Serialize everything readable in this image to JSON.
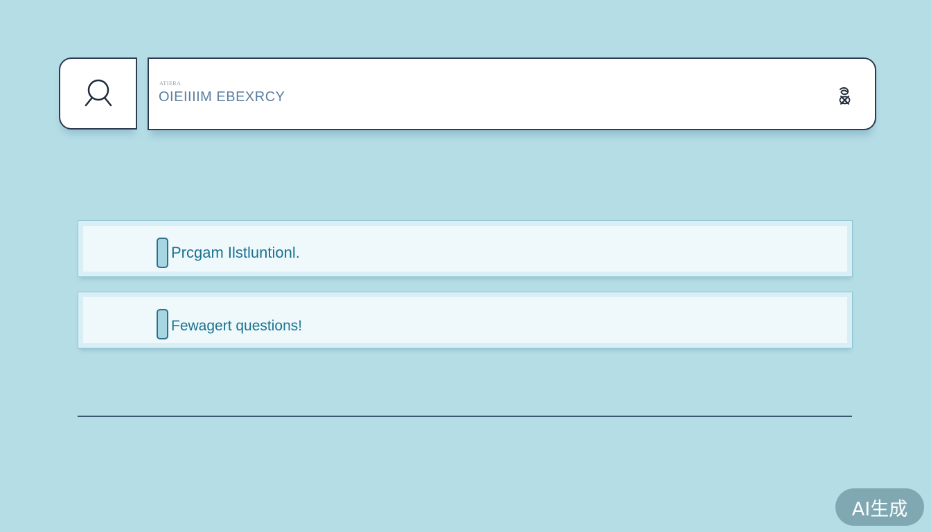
{
  "search": {
    "caption": "ATIERA",
    "value": "OIEIIIIM EBEXRCY",
    "search_icon": "search-icon",
    "clear_icon": "clear-icon"
  },
  "results": [
    {
      "label": "Prcgam Ilstluntionl."
    },
    {
      "label": "Fewagert questions!"
    }
  ],
  "watermark": {
    "label": "AI生成"
  },
  "colors": {
    "background": "#b5dde6",
    "border": "#2d3a52",
    "accent_text": "#1a7290",
    "item_background": "#eff9fb"
  }
}
